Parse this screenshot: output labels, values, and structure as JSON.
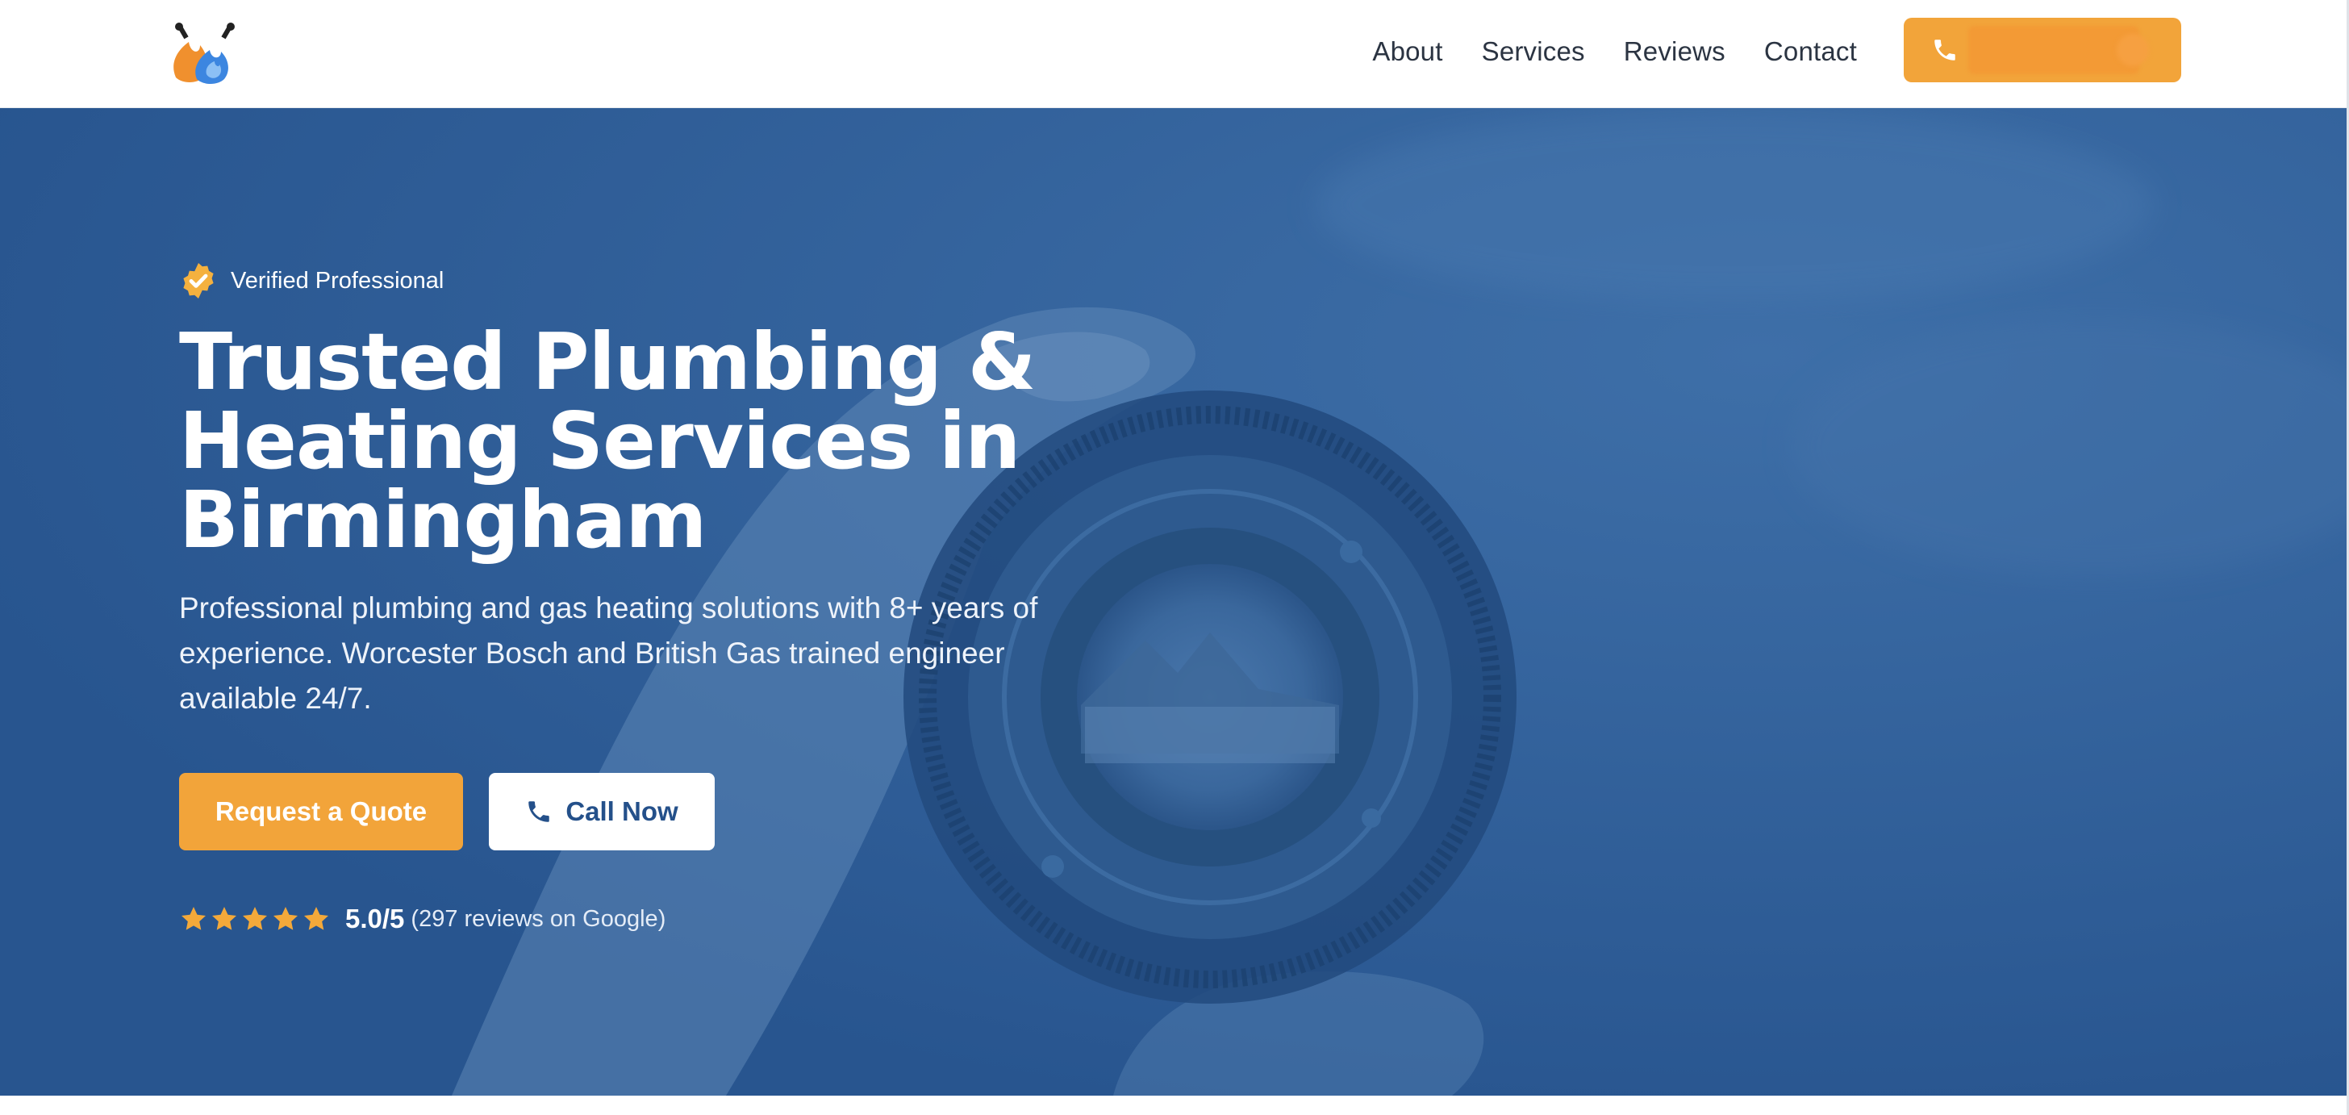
{
  "brand": {
    "logo_icon": "plumbing-flame-logo-icon",
    "colors": {
      "primary": "#2d5c97",
      "accent": "#f2a43a",
      "button_text_blue": "#24508a"
    }
  },
  "header": {
    "nav": [
      {
        "label": "About"
      },
      {
        "label": "Services"
      },
      {
        "label": "Reviews"
      },
      {
        "label": "Contact"
      }
    ],
    "cta": {
      "icon": "phone-icon",
      "label": ""
    }
  },
  "hero": {
    "badge": {
      "icon": "verified-check-icon",
      "label": "Verified Professional"
    },
    "title": "Trusted Plumbing & Heating Services in Birmingham",
    "description": "Professional plumbing and gas heating solutions with 8+ years of experience. Worcester Bosch and British Gas trained engineer available 24/7.",
    "buttons": {
      "quote": "Request a Quote",
      "call": "Call Now",
      "call_icon": "phone-icon"
    },
    "rating": {
      "stars": 5,
      "score": "5.0/5",
      "count_text": "(297 reviews on Google)"
    },
    "background_image": "hand-holding-camera-lens-photo"
  }
}
